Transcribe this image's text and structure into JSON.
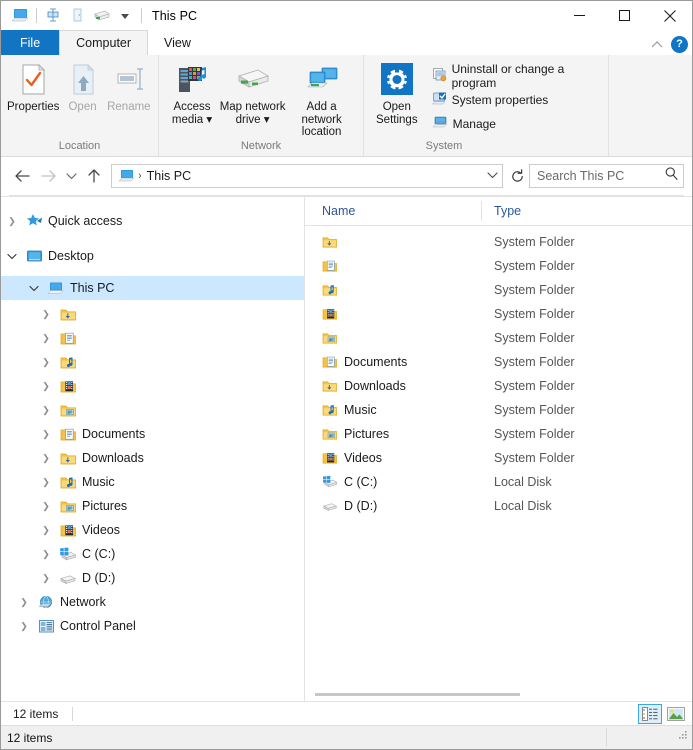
{
  "window": {
    "title": "This PC",
    "minimize_label": "Minimize",
    "maximize_label": "Maximize",
    "close_label": "Close",
    "quick_access_icons": [
      "this-pc-icon",
      "properties-icon",
      "open-icon",
      "map-network-drive-icon",
      "customize-qat-chevron-icon"
    ]
  },
  "tabs": [
    {
      "label": "File",
      "state": "file-menu"
    },
    {
      "label": "Computer",
      "state": "active"
    },
    {
      "label": "View",
      "state": "inactive"
    }
  ],
  "ribbon": {
    "collapse_label": "^",
    "help_label": "?",
    "groups": [
      {
        "title": "Location",
        "buttons": [
          {
            "label": "Properties",
            "icon": "properties-icon",
            "enabled": true
          },
          {
            "label": "Open",
            "icon": "open-icon",
            "enabled": false
          },
          {
            "label": "Rename",
            "icon": "rename-icon",
            "enabled": false
          }
        ]
      },
      {
        "title": "Network",
        "buttons": [
          {
            "label": "Access\nmedia",
            "label_line1": "Access",
            "label_line2": "media",
            "icon": "access-media-icon",
            "enabled": true,
            "dropdown": true
          },
          {
            "label_line1": "Map network",
            "label_line2": "drive",
            "icon": "map-network-drive-icon",
            "enabled": true,
            "dropdown": true
          },
          {
            "label_line1": "Add a network",
            "label_line2": "location",
            "icon": "add-network-location-icon",
            "enabled": true,
            "dropdown": false
          }
        ]
      },
      {
        "title": "System",
        "big_button": {
          "label_line1": "Open",
          "label_line2": "Settings",
          "icon": "open-settings-icon"
        },
        "small_buttons": [
          {
            "label": "Uninstall or change a program",
            "icon": "uninstall-program-icon"
          },
          {
            "label": "System properties",
            "icon": "system-properties-icon"
          },
          {
            "label": "Manage",
            "icon": "manage-icon"
          }
        ]
      }
    ]
  },
  "addressbar": {
    "back_label": "Back",
    "forward_label": "Forward",
    "recent_label": "Recent locations",
    "up_label": "Up",
    "breadcrumb_icon": "this-pc-icon",
    "breadcrumb_separator": "›",
    "breadcrumb_text": "This PC",
    "dropdown_label": "Previous locations",
    "refresh_label": "Refresh",
    "search_placeholder": "Search This PC",
    "search_value": ""
  },
  "navpane": {
    "items": [
      {
        "label": "Quick access",
        "icon": "quick-access-star-icon",
        "indent": 0,
        "twisty": "collapsed",
        "selected": false
      },
      {
        "label": "Desktop",
        "icon": "desktop-monitor-icon",
        "indent": 0,
        "twisty": "expanded",
        "selected": false
      },
      {
        "label": "This PC",
        "icon": "this-pc-icon",
        "indent": 1,
        "twisty": "expanded",
        "selected": true
      },
      {
        "label": "",
        "icon": "downloads-folder-icon",
        "indent": 2,
        "twisty": "collapsed",
        "selected": false
      },
      {
        "label": "",
        "icon": "documents-folder-icon",
        "indent": 2,
        "twisty": "collapsed",
        "selected": false
      },
      {
        "label": "",
        "icon": "music-folder-icon",
        "indent": 2,
        "twisty": "collapsed",
        "selected": false
      },
      {
        "label": "",
        "icon": "videos-folder-icon",
        "indent": 2,
        "twisty": "collapsed",
        "selected": false
      },
      {
        "label": "",
        "icon": "pictures-folder-icon",
        "indent": 2,
        "twisty": "collapsed",
        "selected": false
      },
      {
        "label": "Documents",
        "icon": "documents-folder-icon",
        "indent": 2,
        "twisty": "collapsed",
        "selected": false
      },
      {
        "label": "Downloads",
        "icon": "downloads-folder-icon",
        "indent": 2,
        "twisty": "collapsed",
        "selected": false
      },
      {
        "label": "Music",
        "icon": "music-folder-icon",
        "indent": 2,
        "twisty": "collapsed",
        "selected": false
      },
      {
        "label": "Pictures",
        "icon": "pictures-folder-icon",
        "indent": 2,
        "twisty": "collapsed",
        "selected": false
      },
      {
        "label": "Videos",
        "icon": "videos-folder-icon",
        "indent": 2,
        "twisty": "collapsed",
        "selected": false
      },
      {
        "label": "C (C:)",
        "icon": "windows-drive-icon",
        "indent": 2,
        "twisty": "collapsed",
        "selected": false
      },
      {
        "label": "D (D:)",
        "icon": "local-disk-icon",
        "indent": 2,
        "twisty": "collapsed",
        "selected": false
      },
      {
        "label": "Network",
        "icon": "network-icon",
        "indent": 1,
        "twisty": "collapsed",
        "selected": false
      },
      {
        "label": "Control Panel",
        "icon": "control-panel-icon",
        "indent": 1,
        "twisty": "collapsed",
        "selected": false
      }
    ]
  },
  "filelist": {
    "columns": [
      "Name",
      "Type"
    ],
    "rows": [
      {
        "name": "",
        "type": "System Folder",
        "icon": "downloads-folder-icon"
      },
      {
        "name": "",
        "type": "System Folder",
        "icon": "documents-folder-icon"
      },
      {
        "name": "",
        "type": "System Folder",
        "icon": "music-folder-icon"
      },
      {
        "name": "",
        "type": "System Folder",
        "icon": "videos-folder-icon"
      },
      {
        "name": "",
        "type": "System Folder",
        "icon": "pictures-folder-icon"
      },
      {
        "name": "Documents",
        "type": "System Folder",
        "icon": "documents-folder-icon"
      },
      {
        "name": "Downloads",
        "type": "System Folder",
        "icon": "downloads-folder-icon"
      },
      {
        "name": "Music",
        "type": "System Folder",
        "icon": "music-folder-icon"
      },
      {
        "name": "Pictures",
        "type": "System Folder",
        "icon": "pictures-folder-icon"
      },
      {
        "name": "Videos",
        "type": "System Folder",
        "icon": "videos-folder-icon"
      },
      {
        "name": "C (C:)",
        "type": "Local Disk",
        "icon": "windows-drive-icon"
      },
      {
        "name": "D (D:)",
        "type": "Local Disk",
        "icon": "local-disk-icon"
      }
    ]
  },
  "statusbar": {
    "item_count": "12 items",
    "details_view_label": "Details view",
    "large_icons_view_label": "Large icons view",
    "active_view": "details"
  },
  "outer_statusbar": {
    "text": "12 items"
  },
  "colors": {
    "accent": "#1175c4",
    "selection": "#cce8ff",
    "column_header_text": "#2b5797",
    "ribbon_bg": "#f4f4f4",
    "close_hover": "#e81123"
  }
}
